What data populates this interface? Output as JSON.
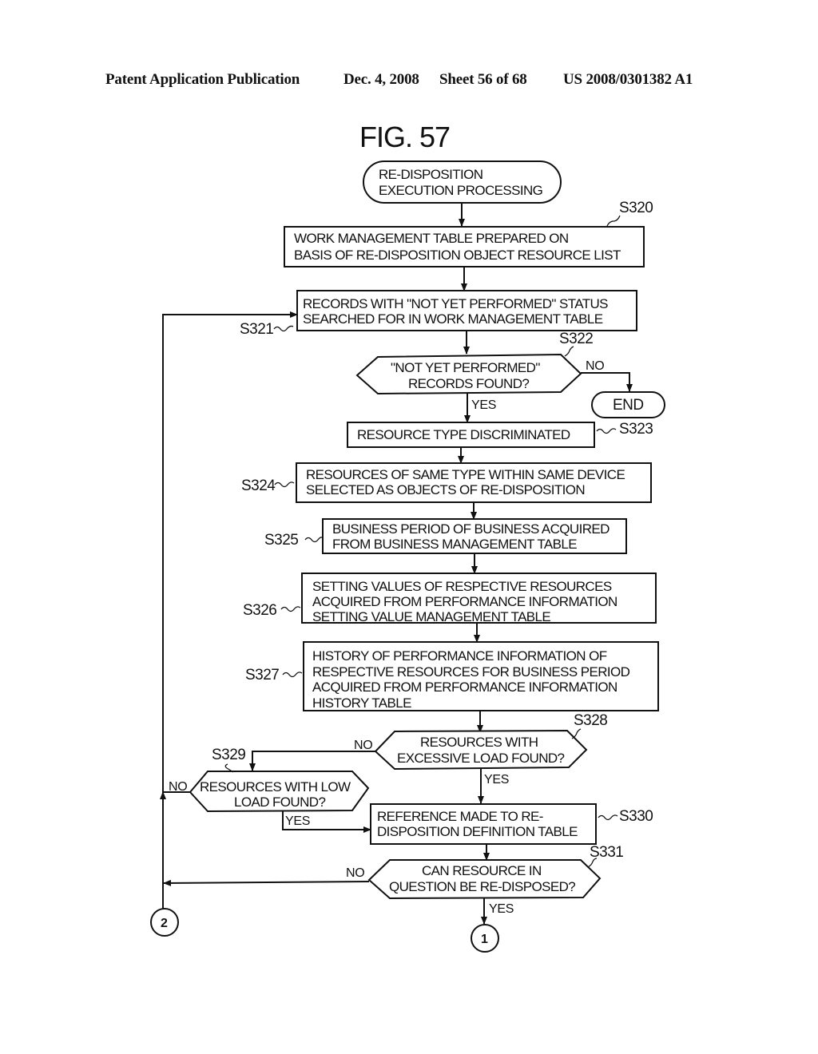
{
  "header": {
    "publication": "Patent Application Publication",
    "date": "Dec. 4, 2008",
    "sheet": "Sheet 56 of 68",
    "number": "US 2008/0301382 A1"
  },
  "figure": {
    "title": "FIG. 57"
  },
  "start": {
    "lines": [
      "RE-DISPOSITION",
      "EXECUTION PROCESSING"
    ]
  },
  "steps": {
    "s320": {
      "id": "S320",
      "lines": [
        "WORK MANAGEMENT TABLE PREPARED ON",
        "BASIS OF RE-DISPOSITION OBJECT RESOURCE LIST"
      ]
    },
    "s321": {
      "id": "S321",
      "lines": [
        "RECORDS WITH \"NOT YET PERFORMED\" STATUS",
        "SEARCHED FOR IN WORK MANAGEMENT TABLE"
      ]
    },
    "s322": {
      "id": "S322",
      "lines": [
        "\"NOT YET PERFORMED\"",
        "RECORDS FOUND?"
      ],
      "yes": "YES",
      "no": "NO"
    },
    "end": {
      "label": "END"
    },
    "s323": {
      "id": "S323",
      "lines": [
        "RESOURCE TYPE DISCRIMINATED"
      ]
    },
    "s324": {
      "id": "S324",
      "lines": [
        "RESOURCES OF SAME TYPE WITHIN SAME DEVICE",
        "SELECTED AS OBJECTS OF RE-DISPOSITION"
      ]
    },
    "s325": {
      "id": "S325",
      "lines": [
        "BUSINESS PERIOD OF BUSINESS ACQUIRED",
        "FROM BUSINESS MANAGEMENT TABLE"
      ]
    },
    "s326": {
      "id": "S326",
      "lines": [
        "SETTING VALUES OF RESPECTIVE RESOURCES",
        "ACQUIRED FROM PERFORMANCE INFORMATION",
        "SETTING VALUE MANAGEMENT TABLE"
      ]
    },
    "s327": {
      "id": "S327",
      "lines": [
        "HISTORY OF PERFORMANCE INFORMATION OF",
        "RESPECTIVE RESOURCES FOR BUSINESS PERIOD",
        "ACQUIRED FROM PERFORMANCE INFORMATION",
        "HISTORY TABLE"
      ]
    },
    "s328": {
      "id": "S328",
      "lines": [
        "RESOURCES WITH",
        "EXCESSIVE LOAD FOUND?"
      ],
      "yes": "YES",
      "no": "NO"
    },
    "s329": {
      "id": "S329",
      "lines": [
        "RESOURCES WITH LOW",
        "LOAD FOUND?"
      ],
      "yes": "YES",
      "no": "NO"
    },
    "s330": {
      "id": "S330",
      "lines": [
        "REFERENCE MADE TO RE-",
        "DISPOSITION DEFINITION TABLE"
      ]
    },
    "s331": {
      "id": "S331",
      "lines": [
        "CAN RESOURCE IN",
        "QUESTION BE RE-DISPOSED?"
      ],
      "yes": "YES",
      "no": "NO"
    }
  },
  "connectors": {
    "c1": "1",
    "c2": "2"
  }
}
